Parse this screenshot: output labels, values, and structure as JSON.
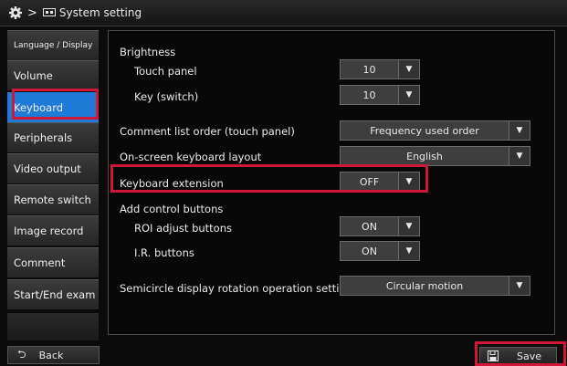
{
  "header": {
    "separator": ">",
    "title": "System setting"
  },
  "sidebar": {
    "items": [
      {
        "label": "Language / Display"
      },
      {
        "label": "Volume"
      },
      {
        "label": "Keyboard"
      },
      {
        "label": "Peripherals"
      },
      {
        "label": "Video output"
      },
      {
        "label": "Remote switch"
      },
      {
        "label": "Image record"
      },
      {
        "label": "Comment"
      },
      {
        "label": "Start/End exam"
      }
    ],
    "active": "Keyboard"
  },
  "settings": {
    "brightness_label": "Brightness",
    "touch_panel_label": "Touch panel",
    "touch_panel_value": "10",
    "key_switch_label": "Key (switch)",
    "key_switch_value": "10",
    "comment_order_label": "Comment list order (touch panel)",
    "comment_order_value": "Frequency used order",
    "kb_layout_label": "On-screen keyboard layout",
    "kb_layout_value": "English",
    "kb_ext_label": "Keyboard extension",
    "kb_ext_value": "OFF",
    "add_buttons_label": "Add control buttons",
    "roi_label": "ROI adjust buttons",
    "roi_value": "ON",
    "ir_label": "I.R. buttons",
    "ir_value": "ON",
    "semicircle_label": "Semicircle display rotation operation setting",
    "semicircle_value": "Circular motion"
  },
  "footer": {
    "back_label": "Back",
    "save_label": "Save"
  },
  "colors": {
    "accent": "#1f7bd8",
    "highlight": "#d0173a"
  },
  "icons": {
    "gear": "gear-icon",
    "monitor": "monitor-icon",
    "back": "back-arrow-icon",
    "save": "save-icon",
    "dropdown": "triangle-down-icon"
  }
}
